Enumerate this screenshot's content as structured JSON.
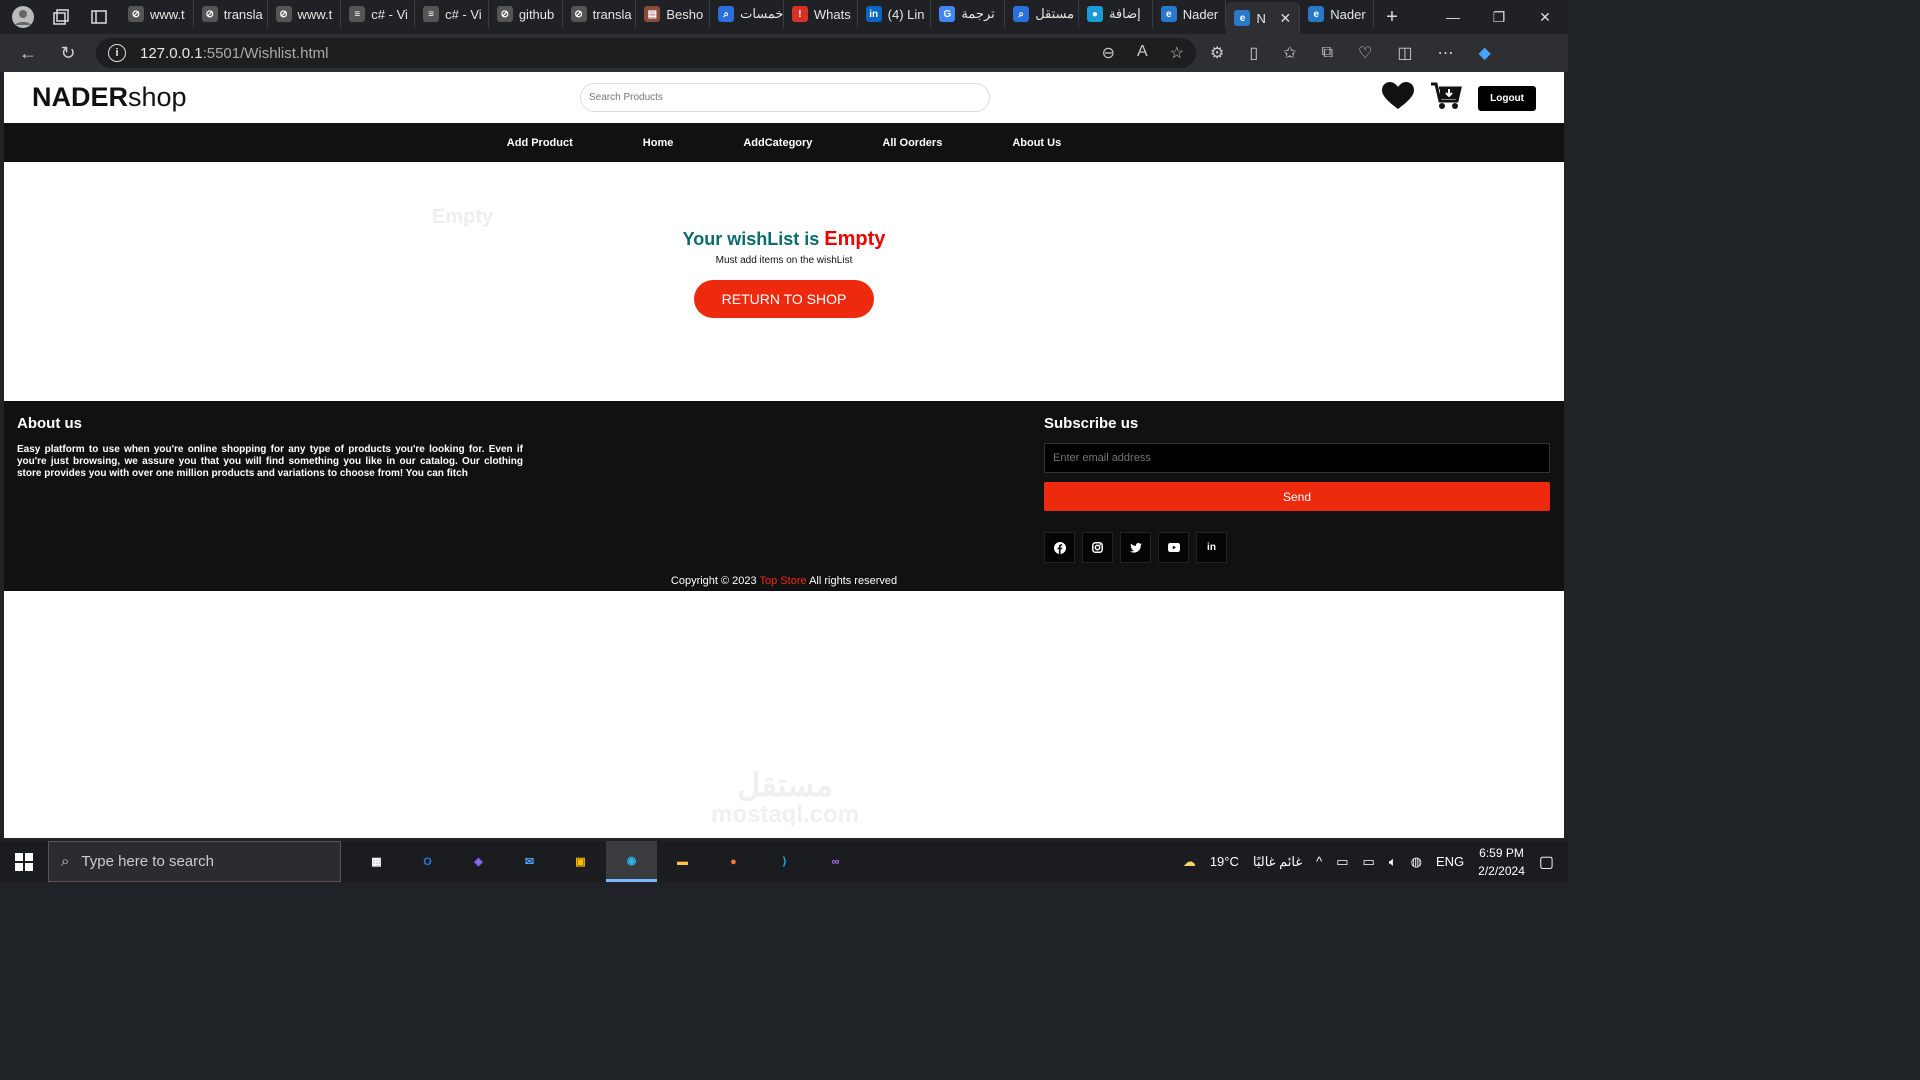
{
  "browser": {
    "tabs": [
      {
        "label": "www.t",
        "icon": "globe"
      },
      {
        "label": "transla",
        "icon": "globe"
      },
      {
        "label": "www.t",
        "icon": "globe"
      },
      {
        "label": "c# - Vi",
        "icon": "stackoverflow"
      },
      {
        "label": "c# - Vi",
        "icon": "stackoverflow"
      },
      {
        "label": "github",
        "icon": "globe"
      },
      {
        "label": "transla",
        "icon": "globe"
      },
      {
        "label": "Besho",
        "icon": "site"
      },
      {
        "label": "خمسات",
        "icon": "search"
      },
      {
        "label": "Whats",
        "icon": "whatsapp"
      },
      {
        "label": "(4) Lin",
        "icon": "linkedin"
      },
      {
        "label": "ترجمة",
        "icon": "translate"
      },
      {
        "label": "مستقل",
        "icon": "search"
      },
      {
        "label": "إضافة",
        "icon": "circle"
      },
      {
        "label": "Nader",
        "icon": "edge-doc"
      },
      {
        "label": "N",
        "icon": "edge-doc",
        "active": true
      },
      {
        "label": "Nader",
        "icon": "edge-doc"
      }
    ],
    "url_host": "127.0.0.1",
    "url_rest": ":5501/Wishlist.html"
  },
  "site": {
    "logo_bold": "NADER",
    "logo_rest": "shop",
    "search_placeholder": "Search Products",
    "logout": "Logout",
    "nav": [
      "Add Product",
      "Home",
      "AddCategory",
      "All Oorders",
      "About Us"
    ]
  },
  "wishlist": {
    "ghost": "Empty",
    "title": "Your wishList is",
    "title_em": "Empty",
    "subtitle": "Must add items on the wishList",
    "return_btn": "RETURN TO SHOP"
  },
  "footer": {
    "about_title": "About us",
    "about_text": "Easy platform to use when you're online shopping for any type of products you're looking for. Even if you're just browsing, we assure you that you will find something you like in our catalog. Our clothing store provides you with over one million products and variations to choose from! You can fitch",
    "subscribe_title": "Subscribe us",
    "email_placeholder": "Enter email address",
    "send": "Send",
    "socials": [
      "facebook",
      "instagram",
      "twitter",
      "youtube",
      "linkedin"
    ],
    "copy_pre": "Copyright © 2023",
    "copy_brand": "Top Store",
    "copy_post": "All rights reserved"
  },
  "watermark": {
    "line1": "مستقل",
    "line2": "mostaql.com"
  },
  "taskbar": {
    "search_placeholder": "Type here to search",
    "weather": "19°C",
    "weather_text": "غائم غالبًا",
    "lang": "ENG",
    "time": "6:59 PM",
    "date": "2/2/2024"
  },
  "colors": {
    "accent": "#ee2a0e",
    "teal": "#0a6b6b",
    "footer": "#111111"
  }
}
